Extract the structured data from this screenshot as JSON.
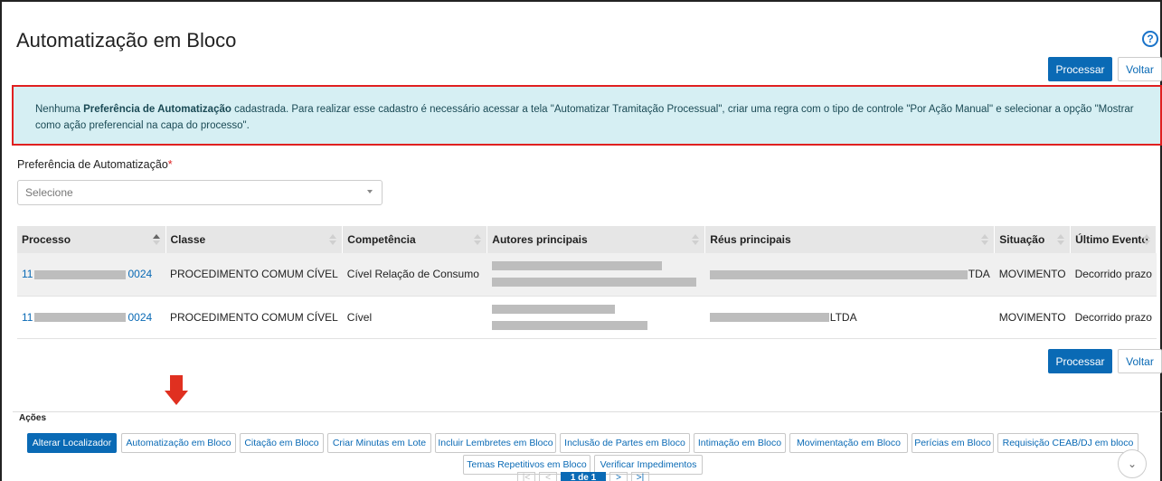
{
  "page": {
    "title": "Automatização em Bloco",
    "help_icon": "?"
  },
  "buttons": {
    "processar": "Processar",
    "voltar": "Voltar"
  },
  "alert": {
    "prefix": "Nenhuma ",
    "bold": "Preferência de Automatização",
    "text": " cadastrada. Para realizar esse cadastro é necessário acessar a tela \"Automatizar Tramitação Processual\", criar uma regra com o tipo de controle \"Por Ação Manual\" e selecionar a opção \"Mostrar como ação preferencial na capa do processo\"."
  },
  "form": {
    "label": "Preferência de Automatização",
    "required_mark": "*",
    "select_value": "Selecione"
  },
  "table": {
    "headers": [
      "Processo",
      "Classe",
      "Competência",
      "Autores principais",
      "Réus principais",
      "Situação",
      "Último Evento"
    ],
    "rows": [
      {
        "processo_prefix": "11",
        "processo_suffix": "0024",
        "classe": "PROCEDIMENTO COMUM CÍVEL",
        "competencia": "Cível Relação de Consumo",
        "reus_suffix": "TDA",
        "situacao": "MOVIMENTO",
        "evento": "Decorrido prazo"
      },
      {
        "processo_prefix": "11",
        "processo_suffix": "0024",
        "classe": "PROCEDIMENTO COMUM CÍVEL",
        "competencia": "Cível",
        "reus_suffix": "LTDA",
        "situacao": "MOVIMENTO",
        "evento": "Decorrido prazo"
      }
    ]
  },
  "acoes": {
    "label": "Ações",
    "items": [
      "Alterar Localizador",
      "Automatização em Bloco",
      "Citação em Bloco",
      "Criar Minutas em Lote",
      "Incluir Lembretes em Bloco",
      "Inclusão de Partes em Bloco",
      "Intimação em Bloco",
      "Movimentação em Bloco",
      "Perícias em Bloco",
      "Requisição CEAB/DJ em bloco",
      "Temas Repetitivos em Bloco",
      "Verificar Impedimentos"
    ]
  },
  "pagination": {
    "current": "1 de 1",
    "first": "|<",
    "prev": "<",
    "next": ">",
    "last": ">|"
  },
  "colors": {
    "primary": "#0a6ab5",
    "alert_bg": "#d6eff3",
    "alert_border": "#e02020",
    "arrow": "#e03020"
  },
  "icons": [
    "help-icon",
    "sort-icon",
    "chevron-down-icon",
    "arrow-down-icon"
  ]
}
